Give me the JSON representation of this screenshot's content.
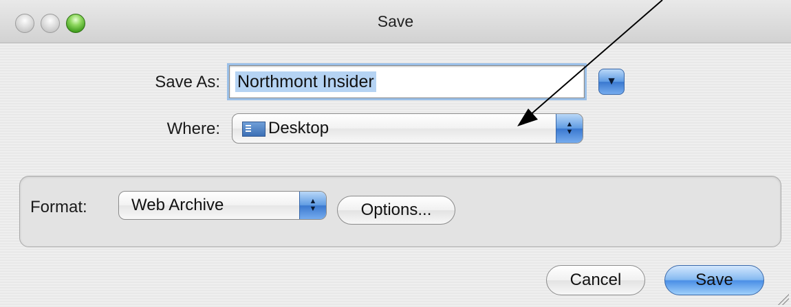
{
  "window": {
    "title": "Save",
    "traffic_lights": [
      "close",
      "minimize",
      "zoom"
    ]
  },
  "save_as": {
    "label": "Save As:",
    "value": "Northmont Insider",
    "expand_icon": "triangle-down-icon"
  },
  "where": {
    "label": "Where:",
    "value": "Desktop",
    "icon": "desktop-folder-icon"
  },
  "format": {
    "label": "Format:",
    "value": "Web Archive",
    "options_label": "Options..."
  },
  "buttons": {
    "cancel_label": "Cancel",
    "save_label": "Save"
  },
  "colors": {
    "accent_blue": "#5f9be3",
    "zoom_green": "#3d9a1a"
  }
}
